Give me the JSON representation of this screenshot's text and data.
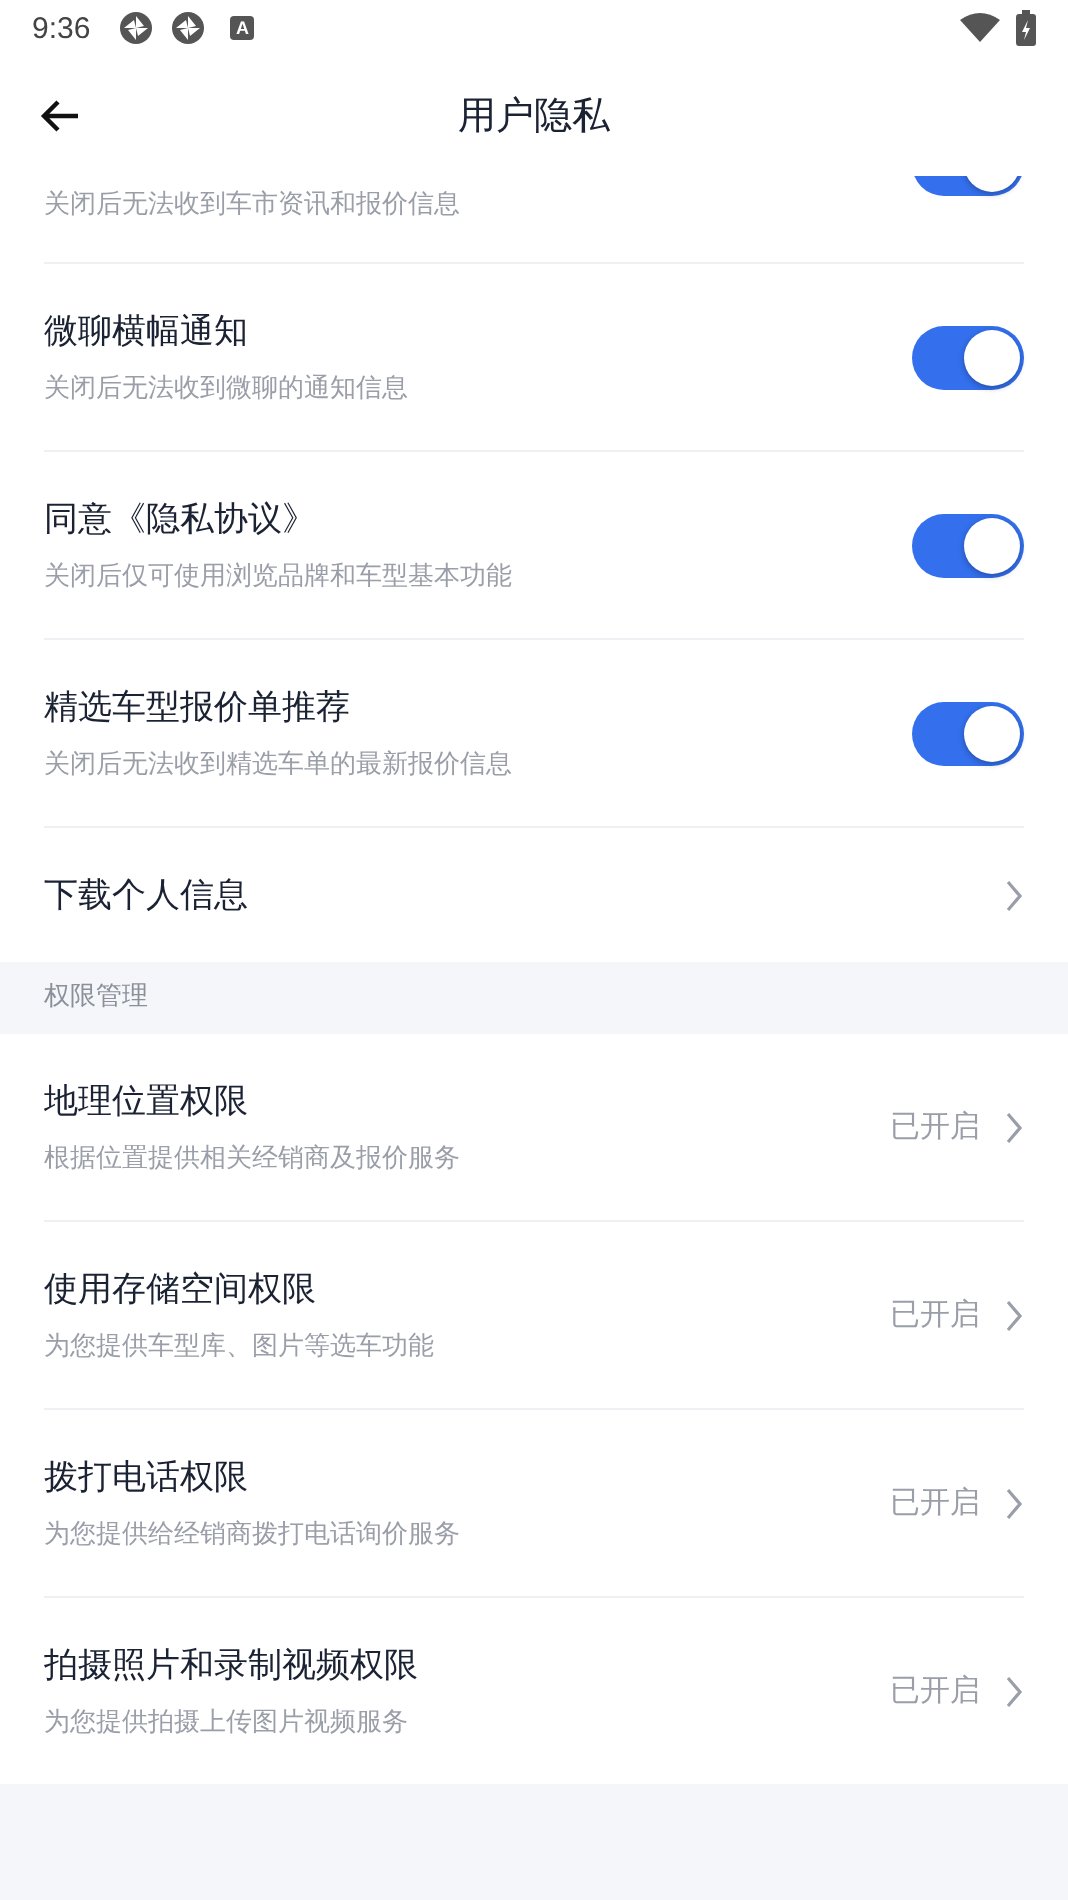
{
  "status_bar": {
    "time": "9:36",
    "badge_letter": "A"
  },
  "header": {
    "title": "用户隐私"
  },
  "settings": [
    {
      "kind": "toggle",
      "subtitle": "关闭后无法收到车市资讯和报价信息",
      "on": true,
      "partial": true
    },
    {
      "kind": "toggle",
      "title": "微聊横幅通知",
      "subtitle": "关闭后无法收到微聊的通知信息",
      "on": true
    },
    {
      "kind": "toggle",
      "title": "同意《隐私协议》",
      "subtitle": "关闭后仅可使用浏览品牌和车型基本功能",
      "on": true
    },
    {
      "kind": "toggle",
      "title": "精选车型报价单推荐",
      "subtitle": "关闭后无法收到精选车单的最新报价信息",
      "on": true
    },
    {
      "kind": "link",
      "title": "下载个人信息"
    }
  ],
  "permissions": {
    "section_title": "权限管理",
    "items": [
      {
        "title": "地理位置权限",
        "subtitle": "根据位置提供相关经销商及报价服务",
        "status": "已开启"
      },
      {
        "title": "使用存储空间权限",
        "subtitle": "为您提供车型库、图片等选车功能",
        "status": "已开启"
      },
      {
        "title": "拨打电话权限",
        "subtitle": "为您提供给经销商拨打电话询价服务",
        "status": "已开启"
      },
      {
        "title": "拍摄照片和录制视频权限",
        "subtitle": "为您提供拍摄上传图片视频服务",
        "status": "已开启"
      }
    ]
  }
}
